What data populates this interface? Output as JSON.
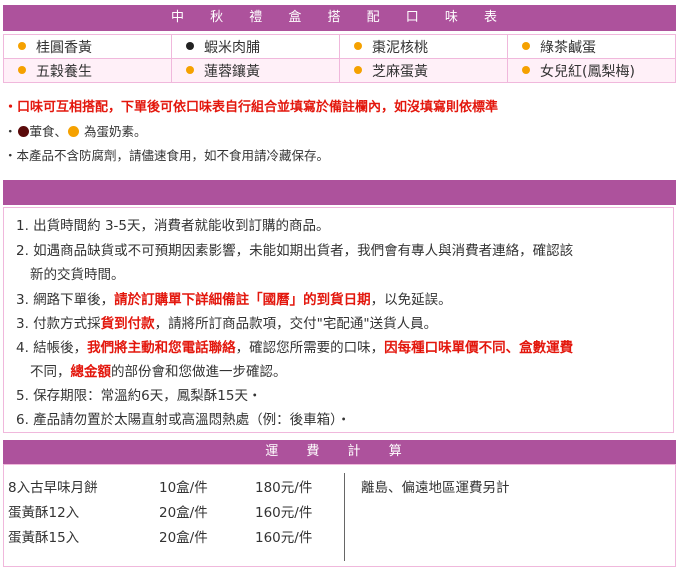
{
  "flavor_table": {
    "title": "中 秋 禮 盒 搭 配 口 味 表",
    "rows": [
      [
        {
          "name": "桂圓香黃",
          "dot": "orange"
        },
        {
          "name": "蝦米肉脯",
          "dot": "dark"
        },
        {
          "name": "棗泥核桃",
          "dot": "orange"
        },
        {
          "name": "綠茶鹹蛋",
          "dot": "orange"
        }
      ],
      [
        {
          "name": "五穀養生",
          "dot": "orange"
        },
        {
          "name": "蓮蓉鑲黃",
          "dot": "orange"
        },
        {
          "name": "芝麻蛋黃",
          "dot": "orange"
        },
        {
          "name": "女兒紅(鳳梨梅)",
          "dot": "orange"
        }
      ]
    ]
  },
  "notes": {
    "line1": "・口味可互相搭配，下單後可依口味表自行組合並填寫於備註欄內，如沒填寫則依標準",
    "line2_prefix": "・",
    "line2_meat": "葷食、",
    "line2_egg": " 為蛋奶素。",
    "line3": "・本產品不含防腐劑，請儘速食用，如不食用請冷藏保存。"
  },
  "shipping": {
    "item1": "1. 出貨時間約  3-5天，消費者就能收到訂購的商品。",
    "item2_line1": "2. 如遇商品缺貨或不可預期因素影響，未能如期出貨者，我們會有專人與消費者連絡，確認該",
    "item2_line2": "新的交貨時間。",
    "item3_a": "3. 網路下單後，",
    "item3_red": "請於訂購單下詳細備註「國曆」的到貨日期",
    "item3_b": "，以免延誤。",
    "item4_a": "3. 付款方式採",
    "item4_red": "貨到付款",
    "item4_b": "，請將所訂商品款項，交付\"宅配通\"送貨人員。",
    "item5_a": "4. 結帳後，",
    "item5_red1": "我們將主動和您電話聯絡",
    "item5_b": "，確認您所需要的口味，",
    "item5_red2": "因每種口味單價不同、盒數運費",
    "item5_line2_a": "不同，",
    "item5_line2_red": "總金額",
    "item5_line2_b": "的部份會和您做進一步確認。",
    "item6": "5. 保存期限：常溫約6天，鳳梨酥15天・",
    "item7": "6. 產品請勿置於太陽直射或高溫悶熱處（例：後車箱）・"
  },
  "freight": {
    "title": "運 費 計 算",
    "rows": [
      {
        "item": "8入古早味月餅",
        "qty": "10盒/件",
        "price": "180元/件"
      },
      {
        "item": "蛋黃酥12入",
        "qty": "20盒/件",
        "price": "160元/件"
      },
      {
        "item": "蛋黃酥15入",
        "qty": "20盒/件",
        "price": "160元/件"
      }
    ],
    "remote_note": "離島、偏遠地區運費另計"
  },
  "colors": {
    "accent_purple": "#ad529c",
    "emphasis_red": "#e3170d",
    "dot_orange": "#f5a100",
    "dot_dark": "#222222",
    "border_pink": "#f0b8dc"
  }
}
